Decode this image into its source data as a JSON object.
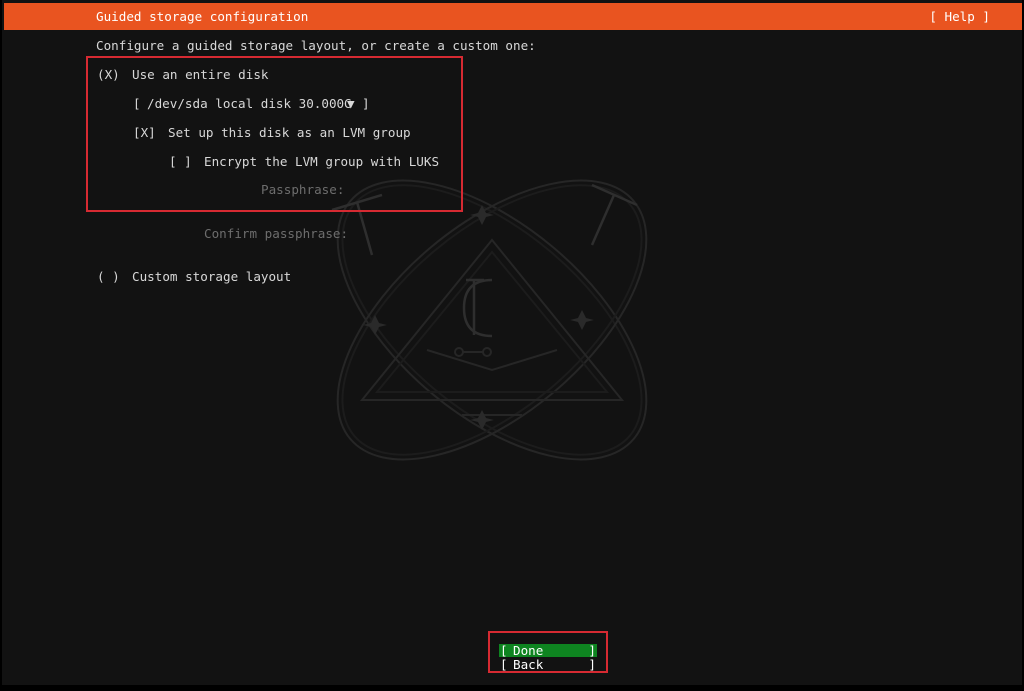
{
  "header": {
    "title": "Guided storage configuration",
    "help_label": "[ Help ]"
  },
  "intro": "Configure a guided storage layout, or create a custom one:",
  "options": {
    "entire_disk": {
      "radio": "(X)",
      "label": "Use an entire disk"
    },
    "disk_select": {
      "open": "[",
      "value": "/dev/sda local disk 30.000G",
      "arrow": "▼",
      "close": "]"
    },
    "lvm": {
      "checkbox": "[X]",
      "label": "Set up this disk as an LVM group"
    },
    "luks": {
      "checkbox": "[ ]",
      "label": "Encrypt the LVM group with LUKS"
    },
    "passphrase_label": "Passphrase:",
    "confirm_passphrase_label": "Confirm passphrase:",
    "custom": {
      "radio": "( )",
      "label": "Custom storage layout"
    }
  },
  "buttons": {
    "done": {
      "open": "[",
      "label": "Done",
      "close": "]"
    },
    "back": {
      "open": "[",
      "label": "Back",
      "close": "]"
    }
  },
  "colors": {
    "header_bg": "#e95420",
    "screen_bg": "#121212",
    "done_bg": "#0e8420",
    "annotation": "#d62a32",
    "text": "#d8d8d8",
    "dim_text": "#6d6d6d"
  }
}
